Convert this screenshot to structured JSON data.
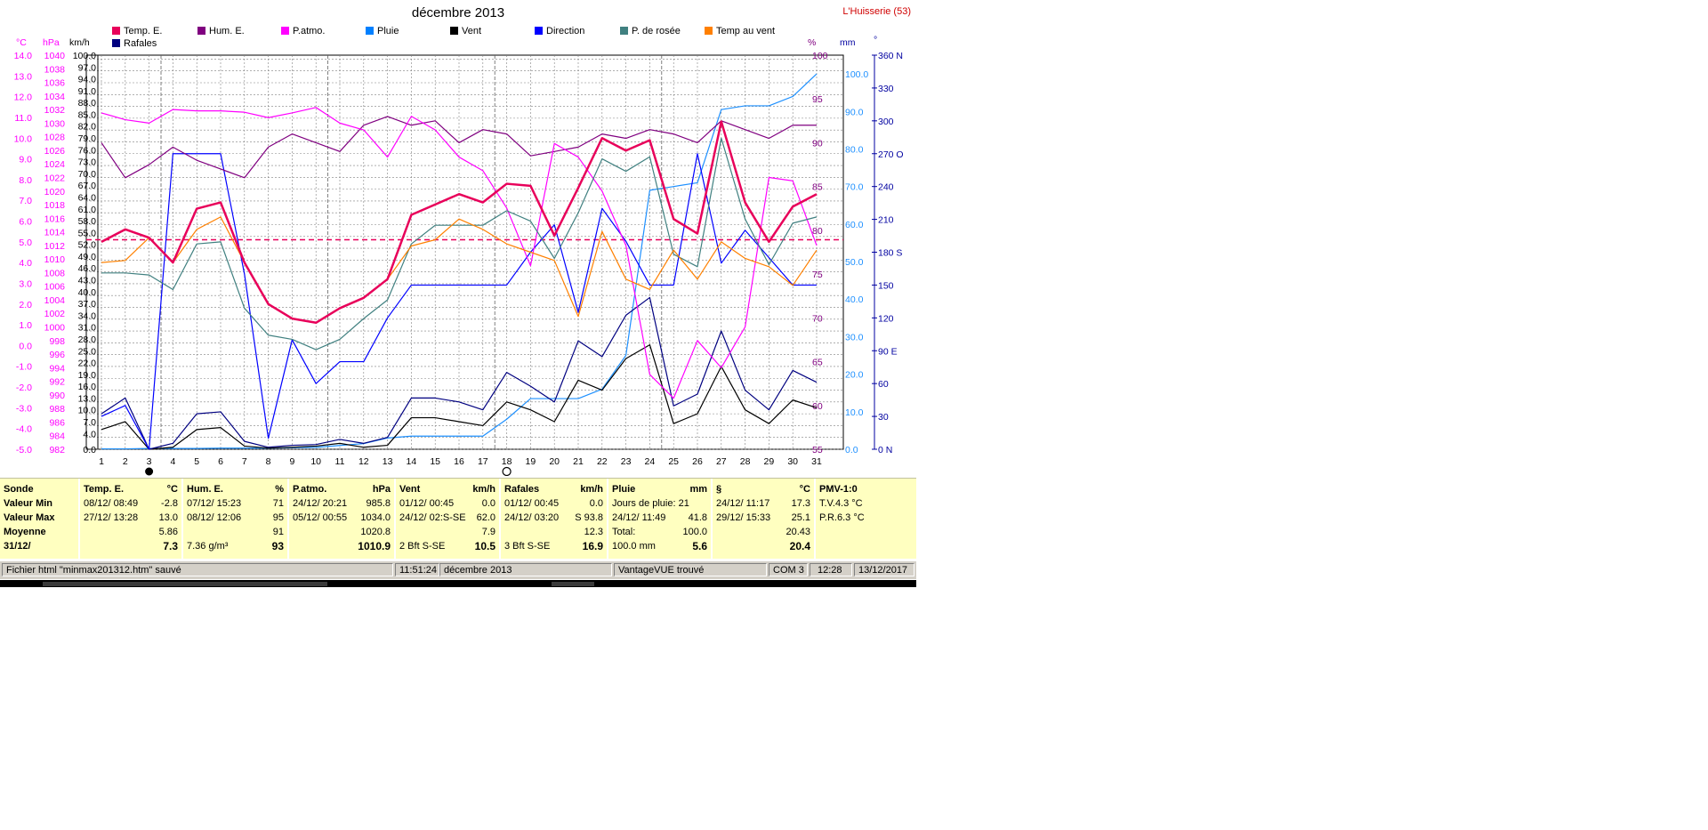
{
  "window": {
    "title": "décembre 2013",
    "station": "L'Huisserie (53)"
  },
  "axes": {
    "left_units": [
      "°C",
      "hPa",
      "km/h"
    ],
    "right_units": [
      "%",
      "mm",
      "°"
    ],
    "temp_ticks": [
      "14.0",
      "13.0",
      "12.0",
      "11.0",
      "10.0",
      "9.0",
      "8.0",
      "7.0",
      "6.0",
      "5.0",
      "4.0",
      "3.0",
      "2.0",
      "1.0",
      "0.0",
      "-1.0",
      "-2.0",
      "-3.0",
      "-4.0",
      "-5.0"
    ],
    "hpa_ticks": [
      "1040",
      "1038",
      "1036",
      "1034",
      "1032",
      "1030",
      "1028",
      "1026",
      "1024",
      "1022",
      "1020",
      "1018",
      "1016",
      "1014",
      "1012",
      "1010",
      "1008",
      "1006",
      "1004",
      "1002",
      "1000",
      "998",
      "996",
      "994",
      "992",
      "990",
      "988",
      "986",
      "984",
      "982"
    ],
    "kmh_ticks": [
      "100.0",
      "97.0",
      "94.0",
      "91.0",
      "88.0",
      "85.0",
      "82.0",
      "79.0",
      "76.0",
      "73.0",
      "70.0",
      "67.0",
      "64.0",
      "61.0",
      "58.0",
      "55.0",
      "52.0",
      "49.0",
      "46.0",
      "43.0",
      "40.0",
      "37.0",
      "34.0",
      "31.0",
      "28.0",
      "25.0",
      "22.0",
      "19.0",
      "16.0",
      "13.0",
      "10.0",
      "7.0",
      "4.0",
      "0.0"
    ],
    "hum_ticks": [
      "100",
      "95",
      "90",
      "85",
      "80",
      "75",
      "70",
      "65",
      "60",
      "55"
    ],
    "rain_ticks": [
      "100.0",
      "90.0",
      "80.0",
      "70.0",
      "60.0",
      "50.0",
      "40.0",
      "30.0",
      "20.0",
      "10.0",
      "0.0"
    ],
    "dir_ticks": [
      "360 N",
      "330",
      "300",
      "270 O",
      "240",
      "210",
      "180 S",
      "150",
      "120",
      "90  E",
      "60",
      "30",
      "0   N"
    ],
    "x_ticks": [
      "1",
      "2",
      "3",
      "4",
      "5",
      "6",
      "7",
      "8",
      "9",
      "10",
      "11",
      "12",
      "13",
      "14",
      "15",
      "16",
      "17",
      "18",
      "19",
      "20",
      "21",
      "22",
      "23",
      "24",
      "25",
      "26",
      "27",
      "28",
      "29",
      "30",
      "31"
    ]
  },
  "legend": [
    {
      "label": "Temp. E.",
      "color": "#e8005a"
    },
    {
      "label": "Hum. E.",
      "color": "#800080"
    },
    {
      "label": "P.atmo.",
      "color": "#ff00ff"
    },
    {
      "label": "Pluie",
      "color": "#0080ff"
    },
    {
      "label": "Vent",
      "color": "#000000"
    },
    {
      "label": "Direction",
      "color": "#0000ff"
    },
    {
      "label": "P. de rosée",
      "color": "#408080"
    },
    {
      "label": "Temp au vent",
      "color": "#ff8000"
    },
    {
      "label": "Rafales",
      "color": "#000080"
    }
  ],
  "chart_data": {
    "type": "line",
    "title": "décembre 2013",
    "x": [
      1,
      2,
      3,
      4,
      5,
      6,
      7,
      8,
      9,
      10,
      11,
      12,
      13,
      14,
      15,
      16,
      17,
      18,
      19,
      20,
      21,
      22,
      23,
      24,
      25,
      26,
      27,
      28,
      29,
      30,
      31
    ],
    "series": [
      {
        "name": "Temp. E.",
        "color": "#e8005a",
        "axis": "temp",
        "width": 2.5,
        "values": [
          5.0,
          5.6,
          5.2,
          4.0,
          6.6,
          6.9,
          4.0,
          2.0,
          1.3,
          1.1,
          1.8,
          2.3,
          3.2,
          6.3,
          6.8,
          7.3,
          6.9,
          7.8,
          7.7,
          5.3,
          7.6,
          10.0,
          9.4,
          9.9,
          6.1,
          5.4,
          10.8,
          6.9,
          5.0,
          6.7,
          7.3
        ]
      },
      {
        "name": "Hum. E.",
        "color": "#800080",
        "axis": "hum",
        "values": [
          90,
          86,
          87.5,
          89.5,
          88,
          87,
          86,
          89.5,
          91,
          90,
          89,
          92,
          93,
          92,
          92.5,
          90,
          91.5,
          91,
          88.5,
          89,
          89.5,
          91,
          90.5,
          91.5,
          91,
          90,
          92.5,
          91.5,
          90.5,
          92,
          92
        ]
      },
      {
        "name": "P.atmo.",
        "color": "#ff00ff",
        "axis": "hpa",
        "values": [
          1031.5,
          1030.5,
          1030,
          1032,
          1031.8,
          1031.8,
          1031.6,
          1030.8,
          1031.5,
          1032.3,
          1030,
          1029,
          1025,
          1031,
          1029,
          1025,
          1023,
          1017.5,
          1009,
          1027,
          1025,
          1020,
          1012,
          993,
          989.5,
          998,
          994,
          1000,
          1022,
          1021.5,
          1012
        ]
      },
      {
        "name": "Pluie",
        "color": "#1e90ff",
        "axis": "rain",
        "values": [
          0.1,
          0.1,
          0.2,
          0.2,
          0.2,
          0.3,
          0.3,
          0.3,
          0.4,
          0.5,
          1.0,
          1.5,
          3.0,
          3.5,
          3.5,
          3.5,
          3.5,
          8.0,
          13.5,
          13.5,
          13.5,
          16.0,
          25.0,
          69.0,
          70.0,
          71.0,
          90.5,
          91.5,
          91.5,
          94.0,
          100.0
        ]
      },
      {
        "name": "Vent",
        "color": "#000000",
        "axis": "kmh",
        "values": [
          5.0,
          7.0,
          0.0,
          0.5,
          5.0,
          5.5,
          0.8,
          0.3,
          0.5,
          0.8,
          1.5,
          0.5,
          1.0,
          8.0,
          8.0,
          7.0,
          6.0,
          12.0,
          10.0,
          7.0,
          17.5,
          15.0,
          23.0,
          26.5,
          6.5,
          9.0,
          21.0,
          10.0,
          6.5,
          12.5,
          10.5
        ]
      },
      {
        "name": "Direction",
        "color": "#0000ff",
        "axis": "dir",
        "values": [
          30,
          40,
          0,
          270,
          270,
          270,
          160,
          10,
          100,
          60,
          80,
          80,
          120,
          150,
          150,
          150,
          150,
          150,
          180,
          205,
          125,
          220,
          190,
          150,
          150,
          270,
          170,
          200,
          175,
          150,
          150
        ]
      },
      {
        "name": "P. de rosée",
        "color": "#408080",
        "axis": "temp",
        "values": [
          3.5,
          3.5,
          3.4,
          2.7,
          4.9,
          5.0,
          1.8,
          0.5,
          0.3,
          -0.2,
          0.3,
          1.3,
          2.2,
          4.9,
          5.8,
          5.8,
          5.8,
          6.5,
          6.0,
          4.2,
          6.4,
          9.0,
          8.4,
          9.1,
          4.4,
          3.8,
          10.0,
          6.1,
          3.9,
          5.9,
          6.2
        ]
      },
      {
        "name": "Temp au vent",
        "color": "#ff8000",
        "axis": "temp",
        "values": [
          4.0,
          4.1,
          5.2,
          4.0,
          5.6,
          6.2,
          4.0,
          2.0,
          1.3,
          1.1,
          1.8,
          2.3,
          3.2,
          4.8,
          5.1,
          6.1,
          5.6,
          4.9,
          4.5,
          4.1,
          1.4,
          5.5,
          3.2,
          2.7,
          4.6,
          3.2,
          5.0,
          4.2,
          3.8,
          2.9,
          4.6
        ]
      },
      {
        "name": "Rafales",
        "color": "#000080",
        "axis": "kmh",
        "values": [
          9.0,
          13.0,
          0.0,
          1.5,
          9.0,
          9.5,
          2.0,
          0.5,
          1.0,
          1.2,
          2.5,
          1.5,
          3.0,
          13.0,
          13.0,
          12.0,
          10.0,
          19.5,
          16.0,
          12.0,
          27.5,
          23.5,
          34.0,
          38.5,
          11.0,
          14.0,
          30.0,
          15.0,
          10.0,
          20.0,
          17.0
        ]
      }
    ],
    "reference_line": {
      "axis": "temp",
      "value": 5.1,
      "color": "#e8005a"
    },
    "markers": [
      {
        "day": 3,
        "symbol": "full-moon"
      },
      {
        "day": 18,
        "symbol": "new-moon"
      }
    ]
  },
  "panel": {
    "sonde": {
      "title": "Sonde",
      "rows": [
        "Valeur Min",
        "Valeur Max",
        "Moyenne",
        "31/12/"
      ]
    },
    "temp": {
      "title": "Temp. E.",
      "unit": "°C",
      "min_date": "08/12/  08:49",
      "min_val": "-2.8",
      "max_date": "27/12/  13:28",
      "max_val": "13.0",
      "avg": "5.86",
      "last": "7.3"
    },
    "hum": {
      "title": "Hum. E.",
      "unit": "%",
      "min_date": "07/12/  15:23",
      "min_val": "71",
      "max_date": "08/12/  12:06",
      "max_val": "95",
      "avg": "91",
      "last_note": "7.36 g/m³",
      "last": "93"
    },
    "patmo": {
      "title": "P.atmo.",
      "unit": "hPa",
      "min_date": "24/12/  20:21",
      "min_val": "985.8",
      "max_date": "05/12/  00:55",
      "max_val": "1034.0",
      "avg": "1020.8",
      "last": "1010.9"
    },
    "vent": {
      "title": "Vent",
      "unit": "km/h",
      "min_date": "01/12/  00:45",
      "min_val": "0.0",
      "max_date": "24/12/  02:S-SE",
      "max_val": "62.0",
      "avg": "7.9",
      "last_note": "2 Bft S-SE",
      "last": "10.5"
    },
    "rafales": {
      "title": "Rafales",
      "unit": "km/h",
      "min_date": "01/12/  00:45",
      "min_val": "0.0",
      "max_date": "24/12/  03:20",
      "max_val": "S 93.8",
      "avg": "12.3",
      "last_note": "3 Bft S-SE",
      "last": "16.9"
    },
    "pluie": {
      "title": "Pluie",
      "unit": "mm",
      "row1": "Jours de pluie: 21",
      "max_date": "24/12/  11:49",
      "max_val": "41.8",
      "total_label": "Total:",
      "total_val": "100.0",
      "last_note": "100.0 mm",
      "last": "5.6"
    },
    "s": {
      "title": "§",
      "unit": "°C",
      "min_date": "24/12/  11:17",
      "min_val": "17.3",
      "max_date": "29/12/  15:33",
      "max_val": "25.1",
      "avg": "20.43",
      "last": "20.4"
    },
    "pmv": {
      "title": "PMV-1:0",
      "tv": "T.V.4.3 °C",
      "pr": "P.R.6.3 °C"
    }
  },
  "status": {
    "file": "Fichier html  \"minmax201312.htm\"  sauvé",
    "time": "11:51:24",
    "month": "décembre 2013",
    "device": "VantageVUE trouvé",
    "port": "COM 3",
    "clock": "12:28",
    "date": "13/12/2017"
  }
}
